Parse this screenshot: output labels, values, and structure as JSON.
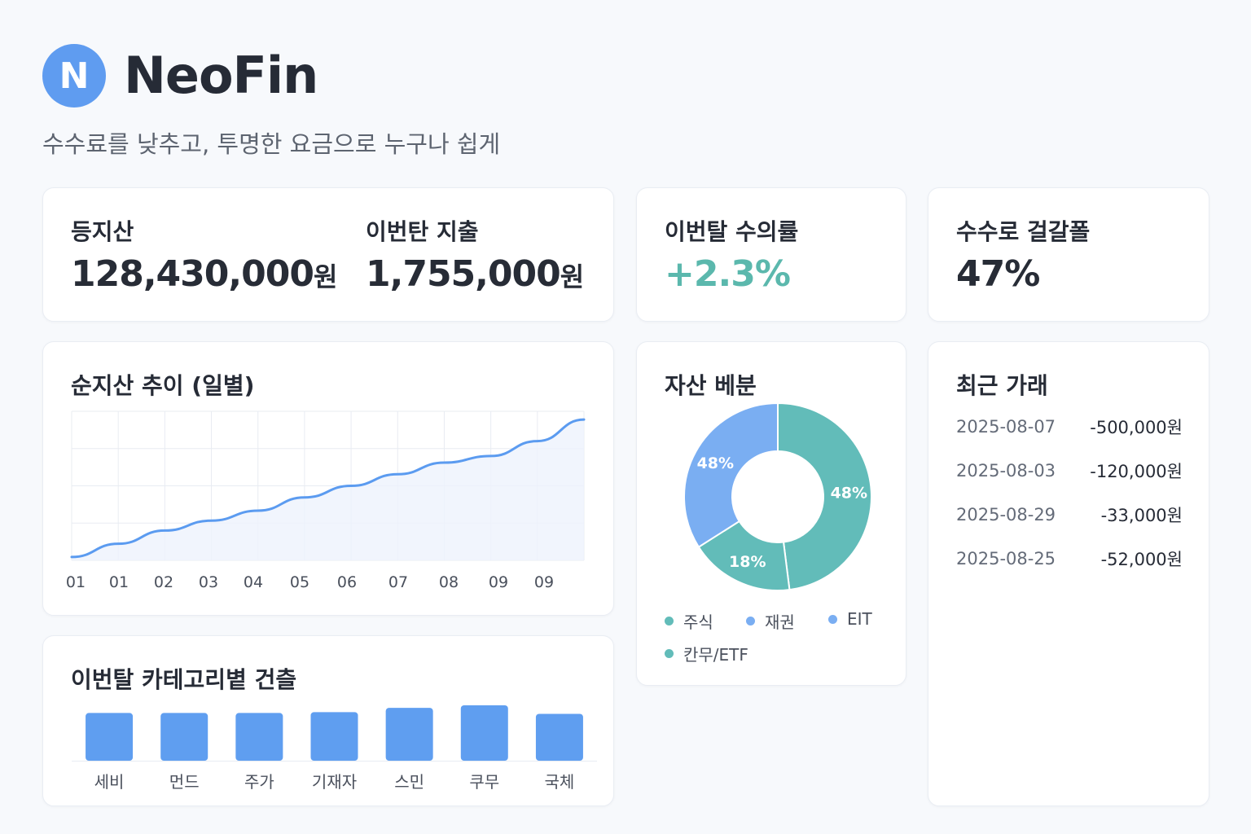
{
  "brand": {
    "logo_letter": "N",
    "name": "NeoFin",
    "tagline": "수수료를 낮추고, 투명한 요금으로 누구나 쉽게"
  },
  "kpis": {
    "total_assets": {
      "label": "등지산",
      "value": "128,430,000",
      "unit": "원"
    },
    "monthly_spend": {
      "label": "이번탄 지출",
      "value": "1,755,000",
      "unit": "원"
    },
    "monthly_return": {
      "label": "이번탈 수의률",
      "value": "+2.3%"
    },
    "fee_savings": {
      "label": "수수로 걸갈폴",
      "value": "47%"
    }
  },
  "colors": {
    "accent_blue": "#5b9bf0",
    "teal": "#62bcb9",
    "positive": "#5bb8ad"
  },
  "net_worth_chart": {
    "title": "순지산 추이 (일별)",
    "chart_data": {
      "type": "area",
      "x_tick_labels": [
        "01",
        "01",
        "02",
        "03",
        "04",
        "05",
        "06",
        "07",
        "08",
        "09",
        "09"
      ],
      "series": [
        {
          "values": [
            2,
            10,
            18,
            24,
            30,
            38,
            45,
            52,
            59,
            63,
            72,
            85
          ]
        }
      ],
      "ylim": [
        0,
        90
      ],
      "grid": true
    }
  },
  "allocation_chart": {
    "title": "자산 베분",
    "chart_data": {
      "type": "pie",
      "slices": [
        {
          "label": "48%",
          "value": 48,
          "color": "#62bcb9"
        },
        {
          "label": "18%",
          "value": 18,
          "color": "#62bcb9"
        },
        {
          "label": "48%",
          "value": 34,
          "color": "#7aaef2"
        }
      ],
      "legend": [
        {
          "label": "주식",
          "color": "#62bcb9"
        },
        {
          "label": "재권",
          "color": "#7aaef2"
        },
        {
          "label": "EIT",
          "color": "#7aaef2"
        },
        {
          "label": "칸무/ETF",
          "color": "#62bcb9"
        }
      ]
    }
  },
  "recent_transactions": {
    "title": "최근 가래",
    "items": [
      {
        "date": "2025-08-07",
        "amount": "-500,000원"
      },
      {
        "date": "2025-08-03",
        "amount": "-120,000원"
      },
      {
        "date": "2025-08-29",
        "amount": "-33,000원"
      },
      {
        "date": "2025-08-25",
        "amount": "-52,000원"
      }
    ]
  },
  "category_spend_chart": {
    "title": "이번탈 카테고리볕 건츨",
    "chart_data": {
      "type": "bar",
      "categories": [
        "세비",
        "먼드",
        "주가",
        "기재자",
        "스민",
        "쿠무",
        "국체"
      ],
      "values": [
        56,
        56,
        56,
        57,
        62,
        65,
        55
      ],
      "ylim": [
        0,
        65
      ]
    }
  }
}
